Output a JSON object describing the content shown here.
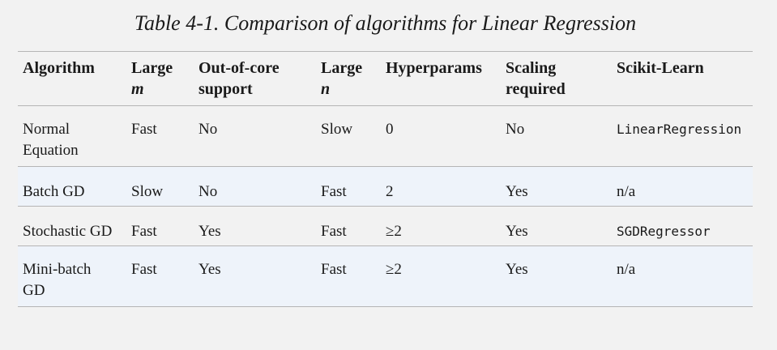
{
  "caption": "Table 4-1. Comparison of algorithms for Linear Regression",
  "header": {
    "algorithm": "Algorithm",
    "large_m": {
      "line1": "Large",
      "line2": "m"
    },
    "out_of_core": {
      "line1": "Out-of-core",
      "line2": "support"
    },
    "large_n": {
      "line1": "Large",
      "line2": "n"
    },
    "hyperparams": "Hyperparams",
    "scaling": {
      "line1": "Scaling",
      "line2": "required"
    },
    "scikit": "Scikit-Learn"
  },
  "rows": [
    {
      "algorithm": {
        "line1": "Normal",
        "line2": "Equation"
      },
      "large_m": "Fast",
      "out_of_core": "No",
      "large_n": "Slow",
      "hyperparams": "0",
      "scaling": "No",
      "scikit": "LinearRegression"
    },
    {
      "algorithm": {
        "line1": "Batch GD",
        "line2": ""
      },
      "large_m": "Slow",
      "out_of_core": "No",
      "large_n": "Fast",
      "hyperparams": "2",
      "scaling": "Yes",
      "scikit": "n/a"
    },
    {
      "algorithm": {
        "line1": "Stochastic GD",
        "line2": ""
      },
      "large_m": "Fast",
      "out_of_core": "Yes",
      "large_n": "Fast",
      "hyperparams": "≥2",
      "scaling": "Yes",
      "scikit": "SGDRegressor"
    },
    {
      "algorithm": {
        "line1": "Mini-batch",
        "line2": "GD"
      },
      "large_m": "Fast",
      "out_of_core": "Yes",
      "large_n": "Fast",
      "hyperparams": "≥2",
      "scaling": "Yes",
      "scikit": "n/a"
    }
  ]
}
